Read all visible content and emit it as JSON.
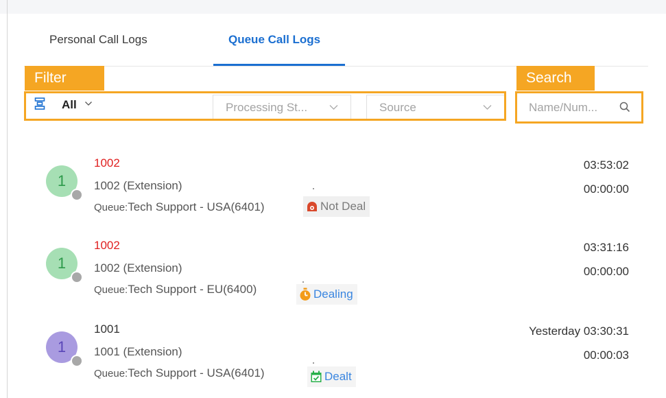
{
  "tabs": {
    "personal": "Personal Call Logs",
    "queue": "Queue Call Logs"
  },
  "annotations": {
    "filter": "Filter",
    "search": "Search"
  },
  "filters": {
    "type_value": "All",
    "processing_status_placeholder": "Processing St...",
    "source_placeholder": "Source"
  },
  "search": {
    "placeholder": "Name/Num..."
  },
  "call_logs": [
    {
      "number": "1002",
      "number_color": "#e02020",
      "avatar_text": "1",
      "avatar_bg": "#a6dfb4",
      "avatar_fg": "#2e9a4b",
      "extension": "1002 (Extension)",
      "queue_label": "Queue:",
      "queue_name": "Tech Support - USA(6401)",
      "status": "Not Deal",
      "status_icon": "not-deal-icon",
      "time": "03:53:02",
      "duration": "00:00:00"
    },
    {
      "number": "1002",
      "number_color": "#e02020",
      "avatar_text": "1",
      "avatar_bg": "#a6dfb4",
      "avatar_fg": "#2e9a4b",
      "extension": "1002 (Extension)",
      "queue_label": "Queue:",
      "queue_name": "Tech Support - EU(6400)",
      "status": "Dealing",
      "status_icon": "stopwatch-icon",
      "time": "03:31:16",
      "duration": "00:00:00"
    },
    {
      "number": "1001",
      "number_color": "#333333",
      "avatar_text": "1",
      "avatar_bg": "#a99be0",
      "avatar_fg": "#5a46b8",
      "extension": "1001 (Extension)",
      "queue_label": "Queue:",
      "queue_name": "Tech Support - USA(6401)",
      "status": "Dealt",
      "status_icon": "calendar-check-icon",
      "time": "Yesterday 03:30:31",
      "duration": "00:00:03"
    }
  ],
  "colors": {
    "accent": "#1b6fd1",
    "annotation": "#f5a623",
    "not_deal": "#d9482b",
    "dealing": "#f39c1a",
    "dealt": "#27b04a"
  }
}
